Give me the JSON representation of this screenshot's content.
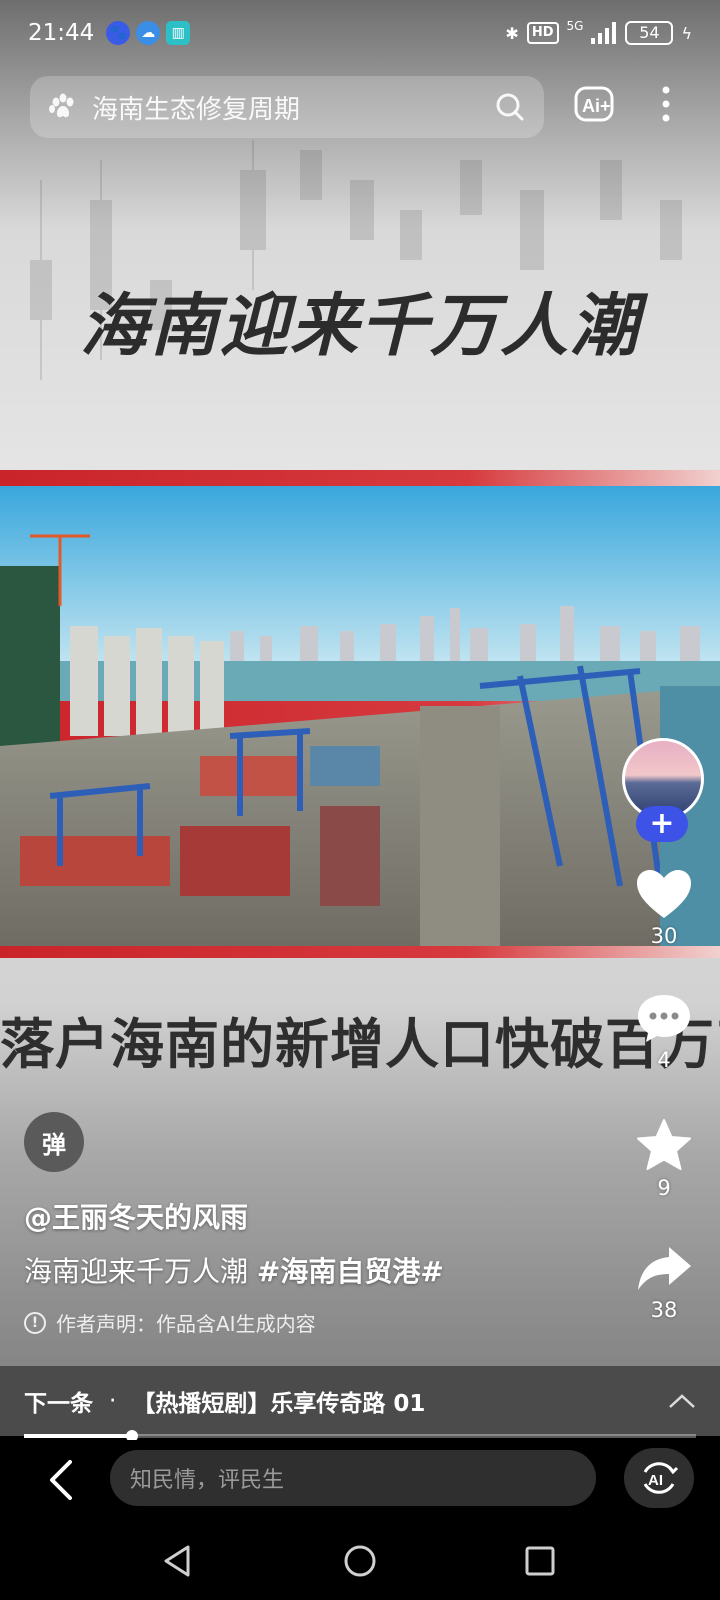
{
  "status_bar": {
    "time": "21:44",
    "network": "5G",
    "hd_label": "HD",
    "battery": "54"
  },
  "search": {
    "placeholder_text": "海南生态修复周期",
    "ai_label": "Ai+"
  },
  "video": {
    "title": "海南迎来千万人潮",
    "caption": "落户海南的新增人口快破百万了"
  },
  "actions": {
    "like_count": "30",
    "comment_count": "4",
    "favorite_count": "9",
    "share_count": "38",
    "follow_label": "+"
  },
  "author": {
    "badge_text": "弹",
    "name": "@王丽冬天的风雨",
    "description_text": "海南迎来千万人潮 ",
    "hashtag": "#海南自贸港#",
    "notice": "作者声明：作品含AI生成内容"
  },
  "next_bar": {
    "label": "下一条",
    "separator": "·",
    "title": "【热播短剧】乐享传奇路 01"
  },
  "playback": {
    "progress_fraction": 0.16
  },
  "comment_bar": {
    "placeholder": "知民情，评民生",
    "ai_label": "AI"
  },
  "icons": [
    "paw-icon",
    "search-icon",
    "ai-plus-icon",
    "more-icon",
    "heart-icon",
    "comment-icon",
    "star-icon",
    "share-icon",
    "info-icon",
    "chevron-up-icon",
    "back-icon",
    "ai-assistant-icon",
    "nav-back-icon",
    "nav-home-icon",
    "nav-recents-icon"
  ],
  "colors": {
    "accent_blue": "#3d52e6",
    "band_red": "#c9242a"
  }
}
